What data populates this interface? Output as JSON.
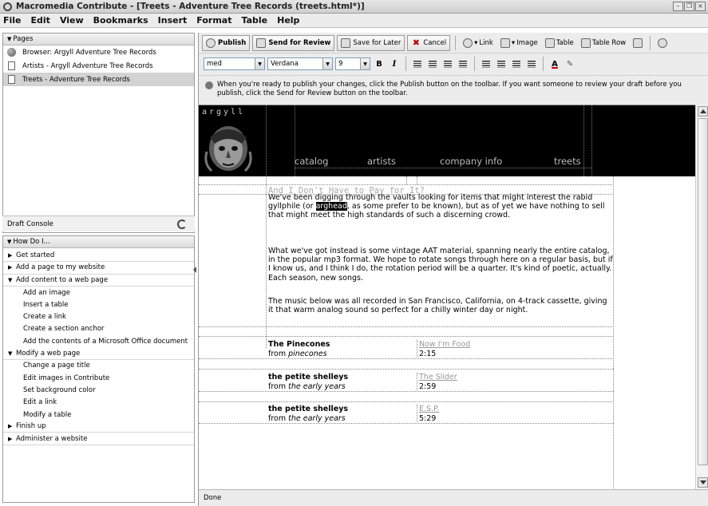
{
  "window": {
    "title": "Macromedia Contribute - [Treets - Adventure Tree Records (treets.html*)]"
  },
  "menu": [
    "File",
    "Edit",
    "View",
    "Bookmarks",
    "Insert",
    "Format",
    "Table",
    "Help"
  ],
  "pages_panel": {
    "title": "Pages",
    "items": [
      {
        "label": "Browser: Argyll Adventure Tree Records",
        "icon": "globe-icon"
      },
      {
        "label": "Artists - Argyll Adventure Tree Records",
        "icon": "page-icon"
      },
      {
        "label": "Treets - Adventure Tree Records",
        "icon": "page-icon",
        "selected": true
      }
    ]
  },
  "draft_console": {
    "label": "Draft Console"
  },
  "howdo": {
    "title": "How Do I...",
    "items": [
      {
        "label": "Get started",
        "type": "section",
        "expanded": false
      },
      {
        "label": "Add a page to my website",
        "type": "section",
        "expanded": false
      },
      {
        "label": "Add content to a web page",
        "type": "section",
        "expanded": true
      },
      {
        "label": "Add an image",
        "type": "child"
      },
      {
        "label": "Insert a table",
        "type": "child"
      },
      {
        "label": "Create a link",
        "type": "child"
      },
      {
        "label": "Create a section anchor",
        "type": "child"
      },
      {
        "label": "Add the contents of a Microsoft Office document",
        "type": "child"
      },
      {
        "label": "Modify a web page",
        "type": "section",
        "expanded": true
      },
      {
        "label": "Change a page title",
        "type": "child"
      },
      {
        "label": "Edit images in Contribute",
        "type": "child"
      },
      {
        "label": "Set background color",
        "type": "child"
      },
      {
        "label": "Edit a link",
        "type": "child"
      },
      {
        "label": "Modify a table",
        "type": "child"
      },
      {
        "label": "Finish up",
        "type": "section",
        "expanded": false
      },
      {
        "label": "Administer a website",
        "type": "section",
        "expanded": false
      }
    ]
  },
  "toolbar": {
    "publish": "Publish",
    "send_review": "Send for Review",
    "save_later": "Save for Later",
    "cancel": "Cancel",
    "link": "Link",
    "image": "Image",
    "table": "Table",
    "table_row": "Table Row"
  },
  "format_bar": {
    "style": "med",
    "font": "Verdana",
    "size": "9"
  },
  "info_message": "When you're ready to publish your changes, click the Publish button on the toolbar. If you want someone to review your draft before you publish, click the Send for Review button on the toolbar.",
  "page": {
    "logo": "argyll",
    "nav": [
      "catalog",
      "artists",
      "company info",
      "treets"
    ],
    "heading": "And I Don't Have to Pay for It?",
    "para1_before": "We've been digging through the vaults looking for items that might interest the rabid gyllphile (or ",
    "para1_highlight": "arghead",
    "para1_after": ", as some prefer to be known), but as of yet we have nothing to sell that might meet the high standards of such a discerning crowd.",
    "para2": "What we've got instead is some vintage AAT material, spanning nearly the entire catalog, in the popular mp3 format. We hope to rotate songs through here on a regular basis, but if I know us, and I think I do, the rotation period will be a quarter. It's kind of poetic, actually. Each season, new songs.",
    "para3": "The music below was all recorded in San Francisco, California, on 4-track cassette, giving it that warm analog sound so perfect for a chilly winter day or night.",
    "tracks": [
      {
        "artist": "The Pinecones",
        "from_label": "from",
        "album": "pinecones",
        "song": "Now I'm Food",
        "time": "2:15"
      },
      {
        "artist": "the petite shelleys",
        "from_label": "from",
        "album": "the early years",
        "song": "The Slider",
        "time": "2:59"
      },
      {
        "artist": "the petite shelleys",
        "from_label": "from",
        "album": "the early years",
        "song": "E.S.P.",
        "time": "5:29"
      }
    ]
  },
  "status": "Done"
}
